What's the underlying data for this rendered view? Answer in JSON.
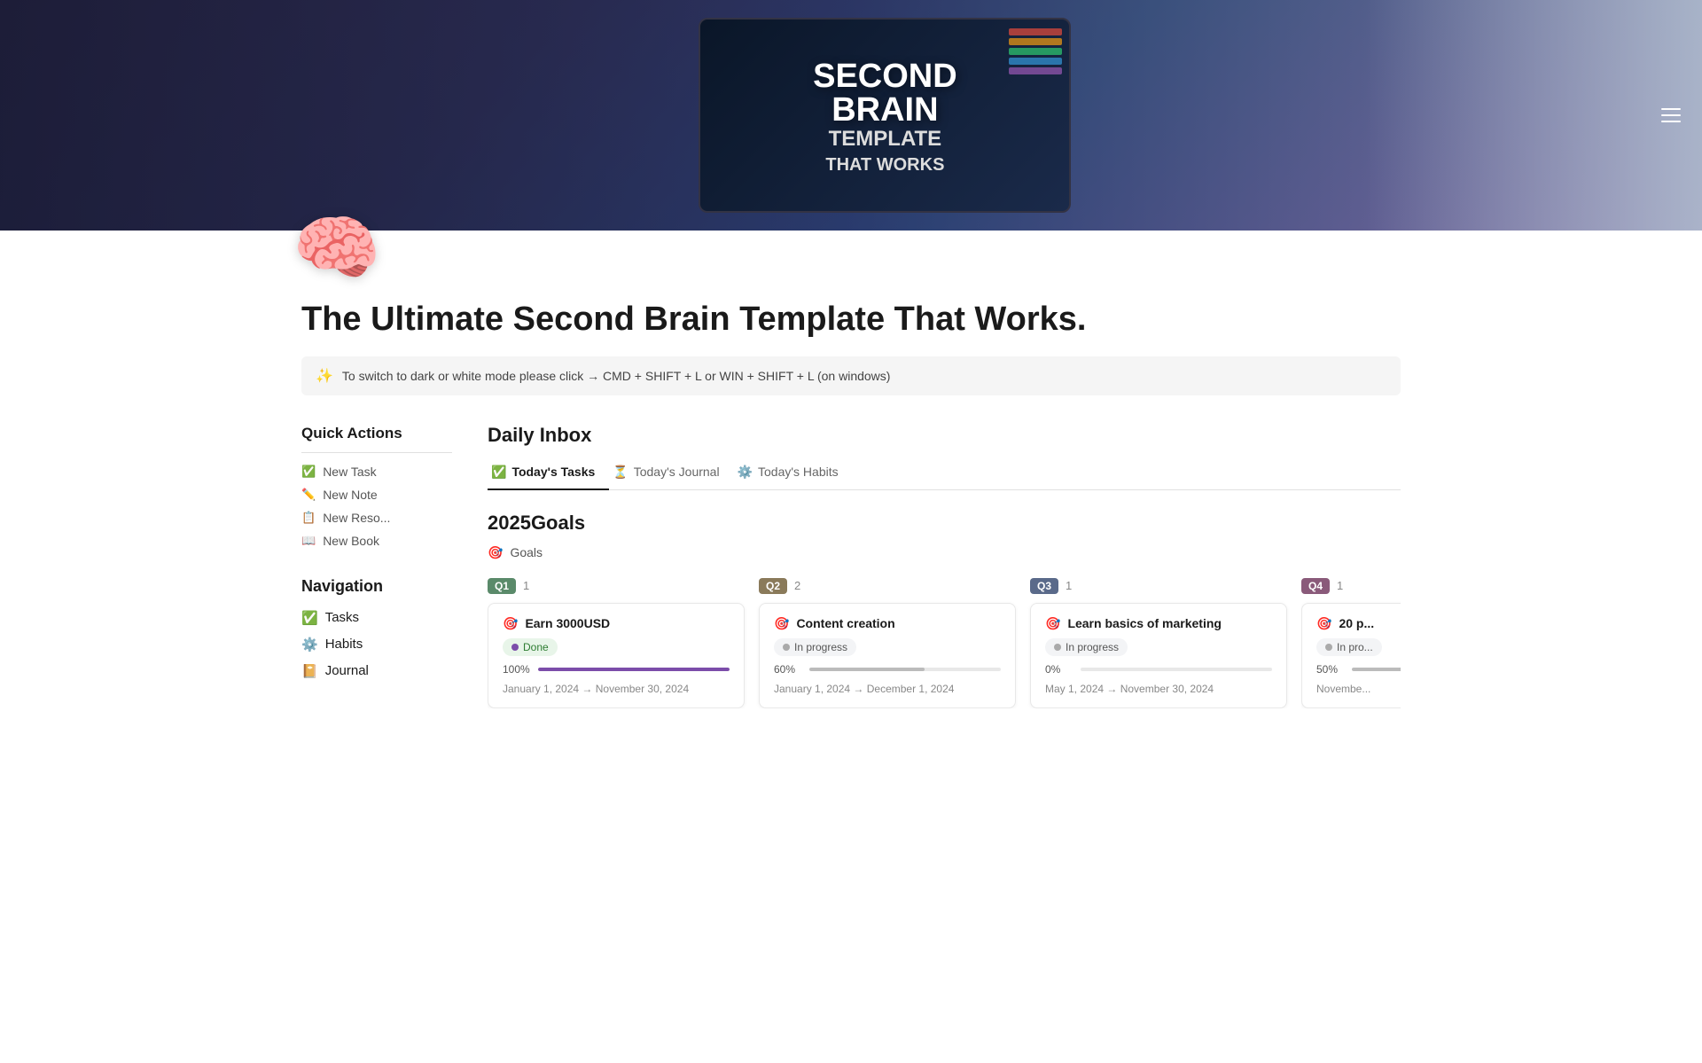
{
  "hero": {
    "title_line1": "SECOND",
    "title_line2": "BRAIN",
    "subtitle_line1": "TEMPLATE",
    "subtitle_line2": "THAT WORKS"
  },
  "page": {
    "brain_emoji": "🧠",
    "main_title": "The Ultimate Second Brain Template That Works.",
    "callout_icon": "✨",
    "callout_text": "To switch to dark or white mode please click → CMD + SHIFT + L or WIN + SHIFT + L (on windows)"
  },
  "sidebar": {
    "quick_actions_title": "Quick Actions",
    "actions": [
      {
        "icon": "✅",
        "label": "New Task"
      },
      {
        "icon": "✏️",
        "label": "New Note"
      },
      {
        "icon": "📋",
        "label": "New Reso..."
      },
      {
        "icon": "📖",
        "label": "New Book"
      }
    ],
    "navigation_title": "Navigation",
    "nav_items": [
      {
        "icon": "✅",
        "label": "Tasks"
      },
      {
        "icon": "⚙️",
        "label": "Habits"
      },
      {
        "icon": "📔",
        "label": "Journal"
      }
    ]
  },
  "daily_inbox": {
    "title": "Daily Inbox",
    "tabs": [
      {
        "icon": "✅",
        "label": "Today's Tasks",
        "active": true
      },
      {
        "icon": "⏳",
        "label": "Today's Journal",
        "active": false
      },
      {
        "icon": "⚙️",
        "label": "Today's Habits",
        "active": false
      }
    ]
  },
  "goals": {
    "section_title": "2025Goals",
    "link_icon": "🎯",
    "link_label": "Goals",
    "columns": [
      {
        "quarter": "Q1",
        "badge_class": "q1-badge",
        "count": "1",
        "card": {
          "goal_icon": "🎯",
          "goal_name": "Earn 3000USD",
          "status_label": "Done",
          "status_class": "status-done",
          "dot_class": "dot-done",
          "progress_pct": 100,
          "progress_label": "100%",
          "fill_class": "fill-purple",
          "date_range": "January 1, 2024 → November 30, 2024"
        }
      },
      {
        "quarter": "Q2",
        "badge_class": "q2-badge",
        "count": "2",
        "card": {
          "goal_icon": "🎯",
          "goal_name": "Content creation",
          "status_label": "In progress",
          "status_class": "status-in-progress",
          "dot_class": "dot-progress",
          "progress_pct": 60,
          "progress_label": "60%",
          "fill_class": "fill-gray",
          "date_range": "January 1, 2024 → December 1, 2024"
        }
      },
      {
        "quarter": "Q3",
        "badge_class": "q3-badge",
        "count": "1",
        "card": {
          "goal_icon": "🎯",
          "goal_name": "Learn basics of marketing",
          "status_label": "In progress",
          "status_class": "status-in-progress",
          "dot_class": "dot-progress",
          "progress_pct": 0,
          "progress_label": "0%",
          "fill_class": "fill-light",
          "date_range": "May 1, 2024 → November 30, 2024"
        }
      },
      {
        "quarter": "Q4",
        "badge_class": "q4-badge",
        "count": "1",
        "card": {
          "goal_icon": "🎯",
          "goal_name": "20 p...",
          "status_label": "In pro...",
          "status_class": "status-in-progress",
          "dot_class": "dot-progress",
          "progress_pct": 50,
          "progress_label": "50%",
          "fill_class": "fill-gray",
          "date_range": "Novembe..."
        }
      }
    ]
  }
}
